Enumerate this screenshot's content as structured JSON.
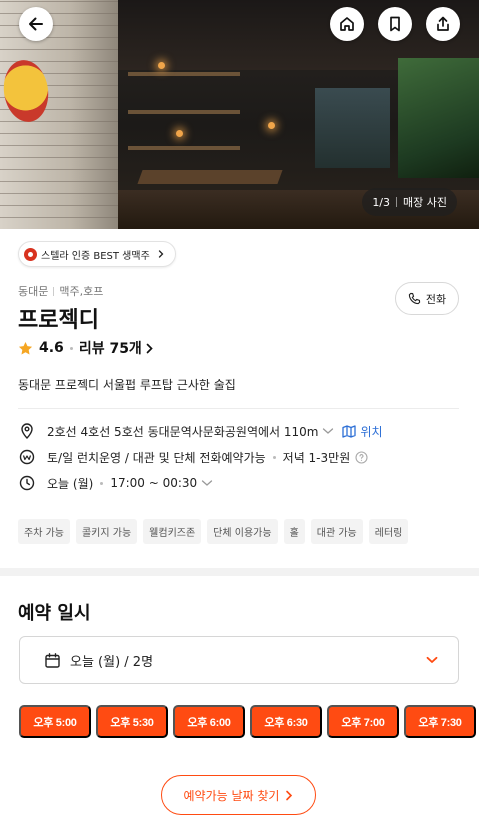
{
  "hero": {
    "counter_current": "1/3",
    "counter_label": "매장 사진"
  },
  "badge": {
    "label": "스텔라 인증 BEST 생맥주"
  },
  "store": {
    "category_area": "동대문",
    "category_type": "맥주,호프",
    "name": "프로젝디",
    "call_label": "전화",
    "rating": "4.6",
    "reviews_label": "리뷰 75개",
    "description": "동대문 프로젝디 서울펍 루프탑 근사한 술집"
  },
  "info": {
    "location_text": "2호선 4호선 5호선 동대문역사문화공원역에서 110m",
    "map_link": "위치",
    "service_text": "토/일 런치운영 / 대관 및 단체 전화예약가능",
    "price_text": "저녁 1-3만원",
    "hours_day": "오늘 (월)",
    "hours_time": "17:00 ~ 00:30"
  },
  "tags": [
    "주차 가능",
    "콜키지 가능",
    "웰컴키즈존",
    "단체 이용가능",
    "홀",
    "대관 가능",
    "레터링"
  ],
  "reservation": {
    "section_title": "예약 일시",
    "date_value": "오늘 (월) / 2명",
    "slots": [
      "오후 5:00",
      "오후 5:30",
      "오후 6:00",
      "오후 6:30",
      "오후 7:00",
      "오후 7:30"
    ],
    "find_button": "예약가능 날짜 찾기"
  },
  "colors": {
    "accent": "#ff4b12",
    "link": "#2d6fd6",
    "badge_icon": "#d8321f",
    "star": "#f5a623"
  },
  "icons": {
    "back": "back-arrow-icon",
    "home": "home-icon",
    "bookmark": "bookmark-icon",
    "share": "share-icon",
    "phone": "phone-icon",
    "star": "star-icon",
    "location": "location-pin-icon",
    "service": "service-info-icon",
    "clock": "clock-icon",
    "calendar": "calendar-icon",
    "map": "map-icon"
  }
}
